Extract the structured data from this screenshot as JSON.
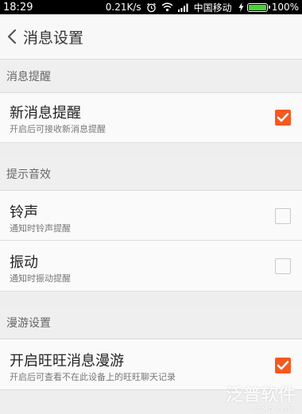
{
  "status_bar": {
    "time": "18:29",
    "speed": "0.21K/s",
    "carrier": "中国移动",
    "battery_text": "100%",
    "battery_color": "#4cd039"
  },
  "header": {
    "back_icon": "chevron-left-icon",
    "title": "消息设置"
  },
  "sections": [
    {
      "title": "消息提醒",
      "items": [
        {
          "label": "新消息提醒",
          "sub": "开启后可接收新消息提醒",
          "checked": true
        }
      ]
    },
    {
      "title": "提示音效",
      "items": [
        {
          "label": "铃声",
          "sub": "通知时铃声提醒",
          "checked": false
        },
        {
          "label": "振动",
          "sub": "通知时振动提醒",
          "checked": false
        }
      ]
    },
    {
      "title": "漫游设置",
      "items": [
        {
          "label": "开启旺旺消息漫游",
          "sub": "开启后可查看不在此设备上的旺旺聊天记录",
          "checked": true
        }
      ]
    }
  ],
  "accent_color": "#f5591f",
  "watermark": {
    "text": "泛普软件",
    "url": "YZMO.COM"
  }
}
